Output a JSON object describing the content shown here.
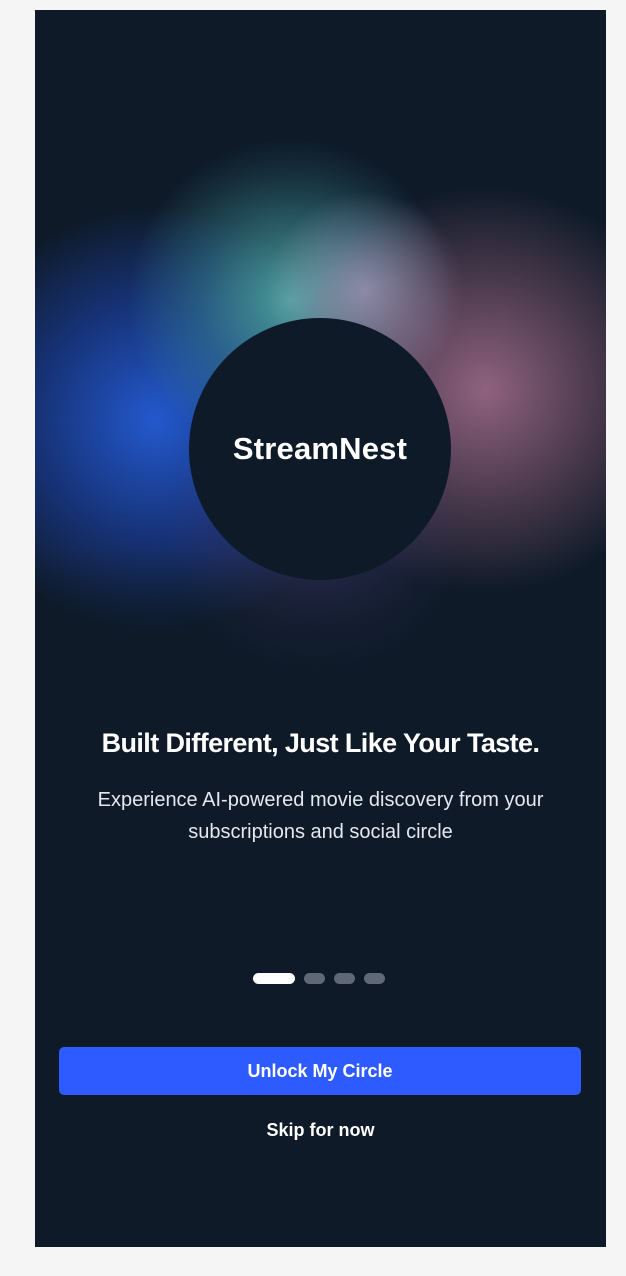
{
  "app": {
    "name": "StreamNest"
  },
  "onboarding": {
    "headline": "Built Different, Just Like Your Taste.",
    "subtitle": "Experience AI-powered movie discovery from your subscriptions and social circle",
    "pagination": {
      "total": 4,
      "current": 1
    },
    "primary_button_label": "Unlock My Circle",
    "skip_label": "Skip for now"
  },
  "colors": {
    "background": "#0e1a28",
    "accent": "#2e5bff",
    "dot_active": "#ffffff",
    "dot_inactive": "#5f6875"
  }
}
